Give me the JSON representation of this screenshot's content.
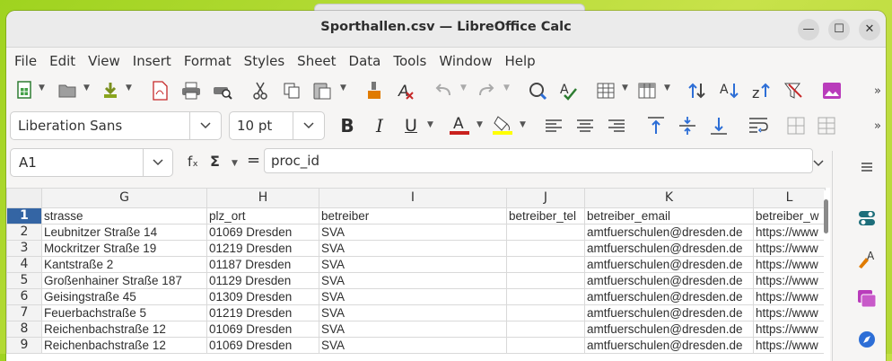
{
  "window": {
    "title": "Sporthallen.csv — LibreOffice Calc",
    "min_symbol": "—",
    "max_symbol": "☐",
    "close_symbol": "✕"
  },
  "menu": [
    "File",
    "Edit",
    "View",
    "Insert",
    "Format",
    "Styles",
    "Sheet",
    "Data",
    "Tools",
    "Window",
    "Help"
  ],
  "toolbar2": {
    "font_name": "Liberation Sans",
    "font_size": "10 pt",
    "bold": "B",
    "italic": "I",
    "underline": "U",
    "font_color_letter": "A"
  },
  "formula_bar": {
    "cell_ref": "A1",
    "fx": "fₓ",
    "sigma": "Σ",
    "equals": "=",
    "content": "proc_id"
  },
  "colors": {
    "accent": "#3465a4",
    "font_color": "#c9211e",
    "highlight": "#ffff00"
  },
  "sheet": {
    "columns": [
      "G",
      "H",
      "I",
      "J",
      "K",
      "L"
    ],
    "rows": [
      {
        "num": "1",
        "cells": [
          "strasse",
          "plz_ort",
          "betreiber",
          "betreiber_tel",
          "betreiber_email",
          "betreiber_w"
        ]
      },
      {
        "num": "2",
        "cells": [
          "Leubnitzer Straße 14",
          "01069 Dresden",
          "SVA",
          "",
          "amtfuerschulen@dresden.de",
          "https://www"
        ]
      },
      {
        "num": "3",
        "cells": [
          "Mockritzer Straße 19",
          "01219 Dresden",
          "SVA",
          "",
          "amtfuerschulen@dresden.de",
          "https://www"
        ]
      },
      {
        "num": "4",
        "cells": [
          "Kantstraße 2",
          "01187 Dresden",
          "SVA",
          "",
          "amtfuerschulen@dresden.de",
          "https://www"
        ]
      },
      {
        "num": "5",
        "cells": [
          "Großenhainer Straße 187",
          "01129 Dresden",
          "SVA",
          "",
          "amtfuerschulen@dresden.de",
          "https://www"
        ]
      },
      {
        "num": "6",
        "cells": [
          "Geisingstraße 45",
          "01309 Dresden",
          "SVA",
          "",
          "amtfuerschulen@dresden.de",
          "https://www"
        ]
      },
      {
        "num": "7",
        "cells": [
          "Feuerbachstraße 5",
          "01219 Dresden",
          "SVA",
          "",
          "amtfuerschulen@dresden.de",
          "https://www"
        ]
      },
      {
        "num": "8",
        "cells": [
          "Reichenbachstraße 12",
          "01069 Dresden",
          "SVA",
          "",
          "amtfuerschulen@dresden.de",
          "https://www"
        ]
      },
      {
        "num": "9",
        "cells": [
          "Reichenbachstraße 12",
          "01069 Dresden",
          "SVA",
          "",
          "amtfuerschulen@dresden.de",
          "https://www"
        ]
      }
    ]
  },
  "icons": {
    "toolbar1": [
      "new-document-icon",
      "open-icon",
      "save-icon",
      "export-pdf-icon",
      "print-icon",
      "print-preview-icon",
      "cut-icon",
      "copy-icon",
      "paste-icon",
      "clone-formatting-icon",
      "clear-formatting-icon",
      "undo-icon",
      "redo-icon",
      "find-replace-icon",
      "spellcheck-icon",
      "row-icon",
      "column-icon",
      "sort-ascending-icon",
      "sort-descending-icon",
      "autofilter-icon",
      "clear-filter-icon",
      "image-icon",
      "overflow-icon"
    ],
    "sidebar": [
      "sidebar-menu-icon",
      "properties-icon",
      "styles-icon",
      "gallery-icon",
      "navigator-icon"
    ]
  }
}
